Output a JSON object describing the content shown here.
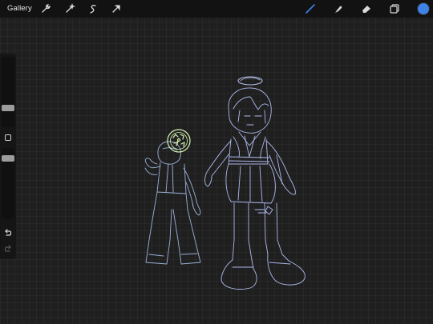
{
  "topbar": {
    "gallery_label": "Gallery",
    "tools_left": [
      {
        "name": "actions-wrench-icon"
      },
      {
        "name": "adjustments-wand-icon"
      },
      {
        "name": "selection-icon"
      },
      {
        "name": "transform-arrow-icon"
      }
    ],
    "tools_right": [
      {
        "name": "brush-icon"
      },
      {
        "name": "smudge-icon"
      },
      {
        "name": "eraser-icon"
      },
      {
        "name": "layers-icon"
      }
    ],
    "active_tool": "brush",
    "active_color": "#3e82e6"
  },
  "sidebar": {
    "brush_size_slider": "size",
    "opacity_slider": "opacity",
    "undo_icon": "undo-icon",
    "redo_icon": "redo-icon"
  },
  "colors": {
    "background": "#1f1f1f",
    "toolbar": "#121212",
    "active_tool": "#3e82e6",
    "sketch_line": "#b9c7ff",
    "halo": "#c4d0ff",
    "circle_badge": "#d6f5b0"
  }
}
